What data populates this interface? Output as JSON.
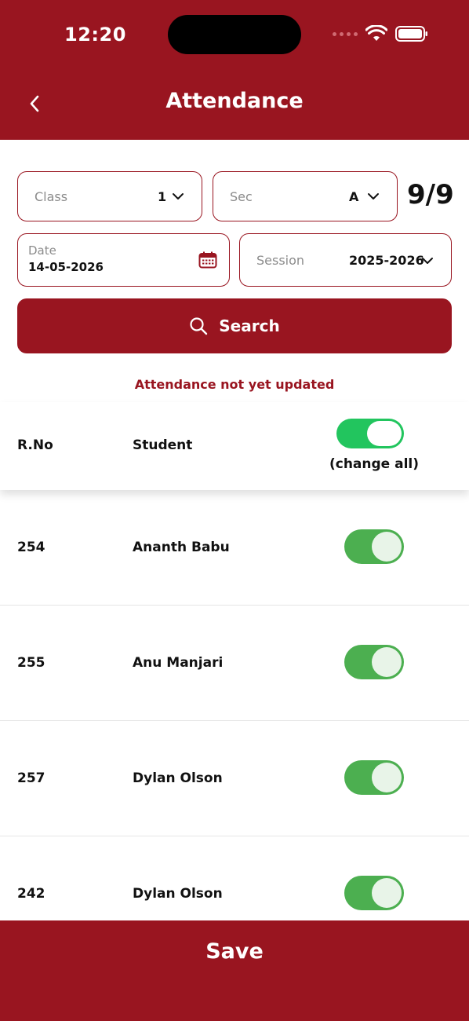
{
  "status_bar": {
    "time": "12:20"
  },
  "header": {
    "title": "Attendance"
  },
  "filters": {
    "class": {
      "label": "Class",
      "value": "1"
    },
    "section": {
      "label": "Sec",
      "value": "A"
    },
    "count": "9/9",
    "date": {
      "label": "Date",
      "value": "14-05-2026"
    },
    "session": {
      "label": "Session",
      "value": "2025-2026"
    }
  },
  "search": {
    "label": "Search"
  },
  "notice": "Attendance not yet updated",
  "table": {
    "headers": {
      "rno": "R.No",
      "student": "Student",
      "change_all": "(change all)"
    },
    "change_all_on": true,
    "rows": [
      {
        "rno": "254",
        "name": "Ananth Babu",
        "present": true
      },
      {
        "rno": "255",
        "name": "Anu Manjari",
        "present": true
      },
      {
        "rno": "257",
        "name": "Dylan Olson",
        "present": true
      },
      {
        "rno": "242",
        "name": "Dylan Olson",
        "present": true
      }
    ]
  },
  "footer": {
    "save_label": "Save"
  },
  "colors": {
    "brand": "#991520",
    "toggle_on": "#4caf50",
    "toggle_all_on": "#22c55e"
  }
}
